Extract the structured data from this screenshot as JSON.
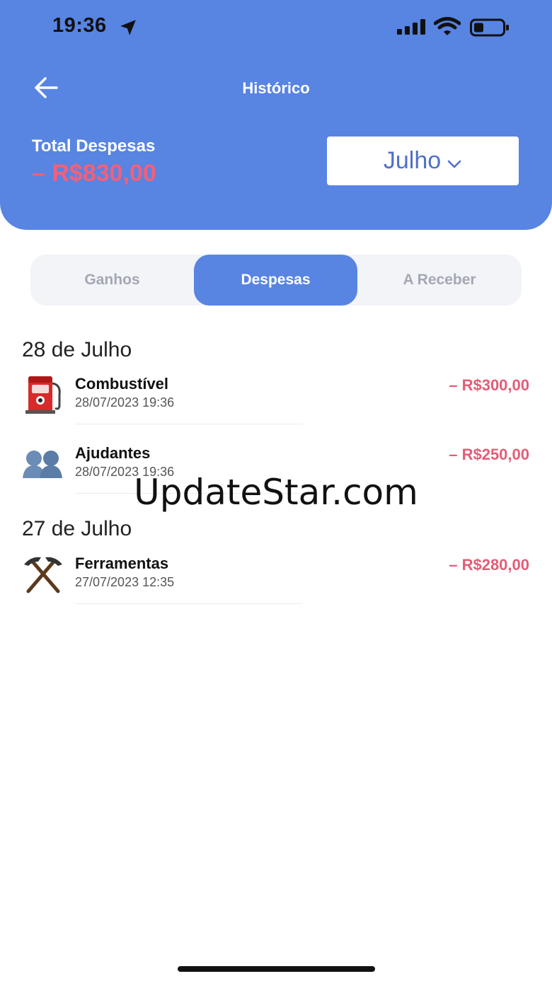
{
  "status_bar": {
    "time": "19:36"
  },
  "header": {
    "title": "Histórico",
    "total_label": "Total Despesas",
    "total_value": "– R$830,00",
    "month": "Julho"
  },
  "tabs": [
    {
      "label": "Ganhos",
      "active": false
    },
    {
      "label": "Despesas",
      "active": true
    },
    {
      "label": "A Receber",
      "active": false
    }
  ],
  "groups": [
    {
      "date": "28 de Julho",
      "items": [
        {
          "icon": "fuel-pump-icon",
          "name": "Combustível",
          "timestamp": "28/07/2023 19:36",
          "amount": "– R$300,00"
        },
        {
          "icon": "people-icon",
          "name": "Ajudantes",
          "timestamp": "28/07/2023 19:36",
          "amount": "– R$250,00"
        }
      ]
    },
    {
      "date": "27 de Julho",
      "items": [
        {
          "icon": "hammer-pick-icon",
          "name": "Ferramentas",
          "timestamp": "27/07/2023 12:35",
          "amount": "– R$280,00"
        }
      ]
    }
  ],
  "watermark": "UpdateStar.com",
  "colors": {
    "primary": "#5884e2",
    "negative": "#e35d77",
    "tab_inactive_text": "#a3a8b2"
  }
}
